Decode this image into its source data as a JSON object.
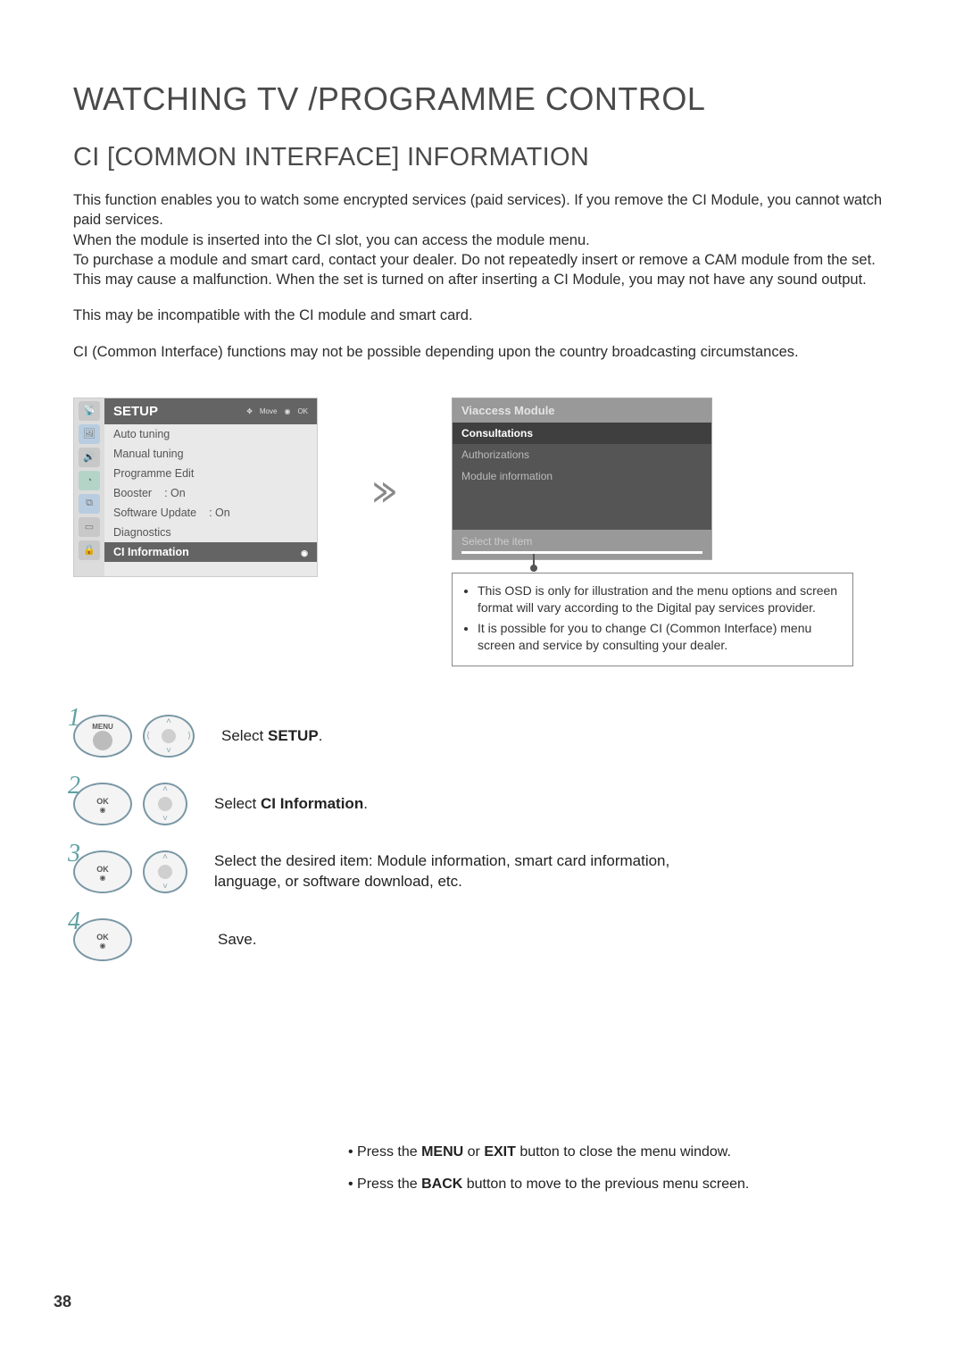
{
  "title": "WATCHING TV /PROGRAMME CONTROL",
  "subtitle": "CI [COMMON INTERFACE] INFORMATION",
  "para1": "This function enables you to watch some encrypted services (paid services). If you remove the CI Module, you cannot watch paid services.",
  "para2": "When the module is inserted into the CI slot, you can access the module menu.",
  "para3": "To purchase a module and smart card, contact your dealer. Do not repeatedly insert or remove a CAM module from the set. This may cause a malfunction. When the set is turned on after inserting a CI Module, you may not have any sound output.",
  "para4": "This may be incompatible with the CI module and smart card.",
  "para5": "CI (Common Interface) functions may not be possible depending upon the country broadcasting circumstances.",
  "setup": {
    "header": "SETUP",
    "nav_move": "Move",
    "nav_ok": "OK",
    "items": [
      {
        "label": "Auto tuning",
        "value": ""
      },
      {
        "label": "Manual tuning",
        "value": ""
      },
      {
        "label": "Programme Edit",
        "value": ""
      },
      {
        "label": "Booster",
        "value": ": On"
      },
      {
        "label": "Software Update",
        "value": ": On"
      },
      {
        "label": "Diagnostics",
        "value": ""
      },
      {
        "label": "CI Information",
        "value": ""
      }
    ]
  },
  "viaccess": {
    "title": "Viaccess Module",
    "rows": [
      "Consultations",
      "Authorizations",
      "Module information"
    ],
    "hint": "Select the item"
  },
  "notes": [
    "This OSD is only for illustration and the menu options and screen format will vary according to the Digital pay services provider.",
    "It is possible for you to change CI (Common Interface) menu screen and service by consulting your dealer."
  ],
  "steps": {
    "s1_pre": "Select ",
    "s1_bold": "SETUP",
    "s1_post": ".",
    "s2_pre": "Select ",
    "s2_bold": "CI Information",
    "s2_post": ".",
    "s3": "Select the desired item: Module information, smart card information, language, or software download, etc.",
    "s4": "Save."
  },
  "buttons": {
    "menu": "MENU",
    "ok": "OK"
  },
  "footer": {
    "l1_pre": "• Press the ",
    "l1_b1": "MENU",
    "l1_mid": " or ",
    "l1_b2": "EXIT",
    "l1_post": " button to close the menu window.",
    "l2_pre": "• Press the ",
    "l2_b1": "BACK",
    "l2_post": " button to move to the previous menu screen."
  },
  "page_number": "38"
}
